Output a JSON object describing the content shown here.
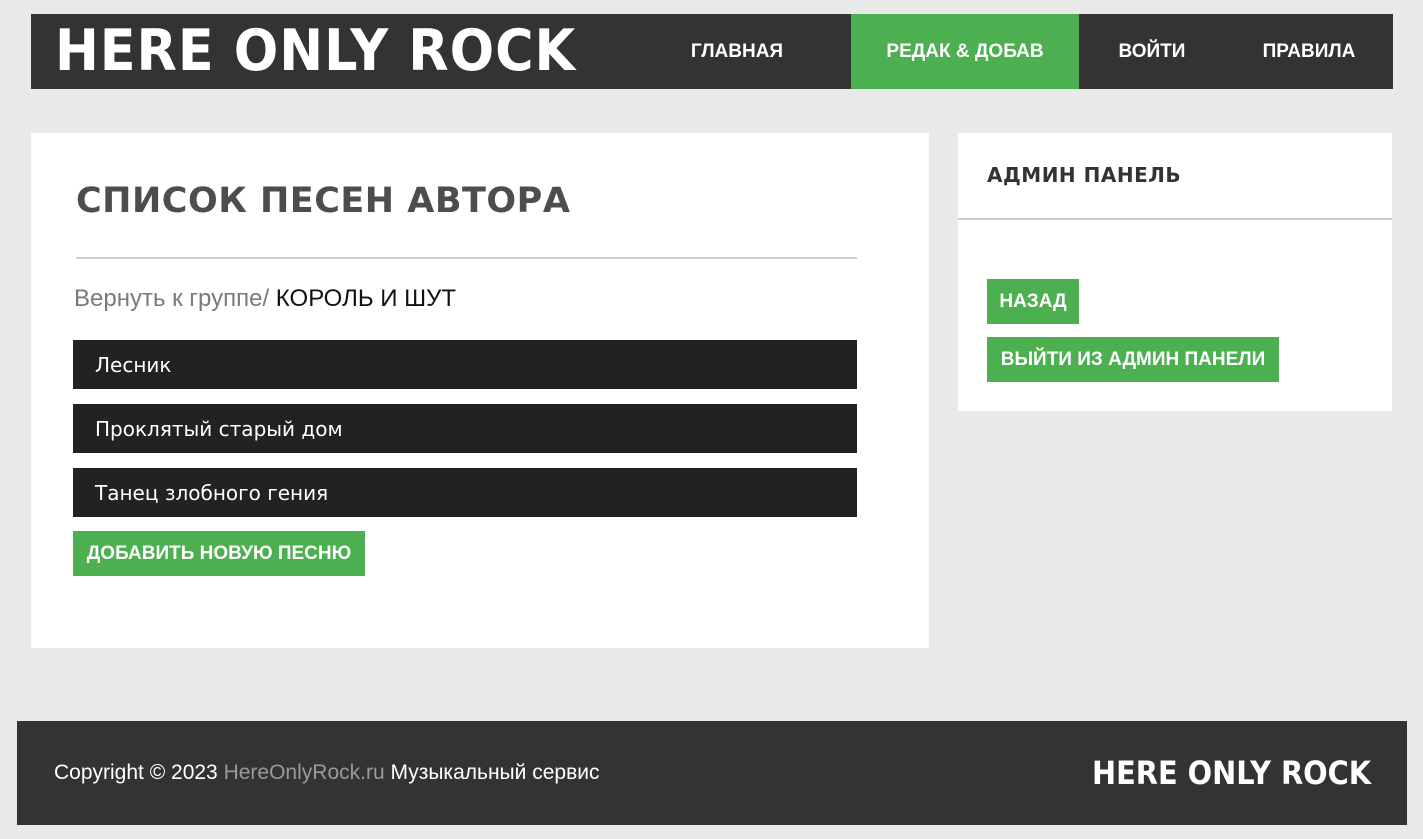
{
  "header": {
    "logo": "HERE ONLY ROCK",
    "nav": [
      {
        "label": "ГЛАВНАЯ",
        "active": false
      },
      {
        "label": "РЕДАК & ДОБАВ",
        "active": true
      },
      {
        "label": "ВОЙТИ",
        "active": false
      },
      {
        "label": "ПРАВИЛА",
        "active": false
      }
    ]
  },
  "main": {
    "title": "СПИСОК ПЕСЕН АВТОРА",
    "breadcrumb": {
      "back_label": "Вернуть к группе/",
      "group_name": " КОРОЛЬ И ШУТ"
    },
    "songs": [
      {
        "title": "Лесник"
      },
      {
        "title": "Проклятый старый дом"
      },
      {
        "title": "Танец злобного гения"
      }
    ],
    "add_song_label": "ДОБАВИТЬ НОВУЮ ПЕСНЮ"
  },
  "sidebar": {
    "title": "АДМИН ПАНЕЛЬ",
    "back_label": "НАЗАД",
    "exit_label": "ВЫЙТИ ИЗ АДМИН ПАНЕЛИ"
  },
  "footer": {
    "copyright_prefix": "Copyright © 2023 ",
    "site_name": "HereOnlyRock.ru",
    "service_text": " Музыкальный сервис",
    "logo": "HERE ONLY ROCK"
  },
  "colors": {
    "accent": "#4caf50",
    "header_bg": "#333333",
    "song_bg": "#222222",
    "page_bg": "#e8e9e8"
  }
}
